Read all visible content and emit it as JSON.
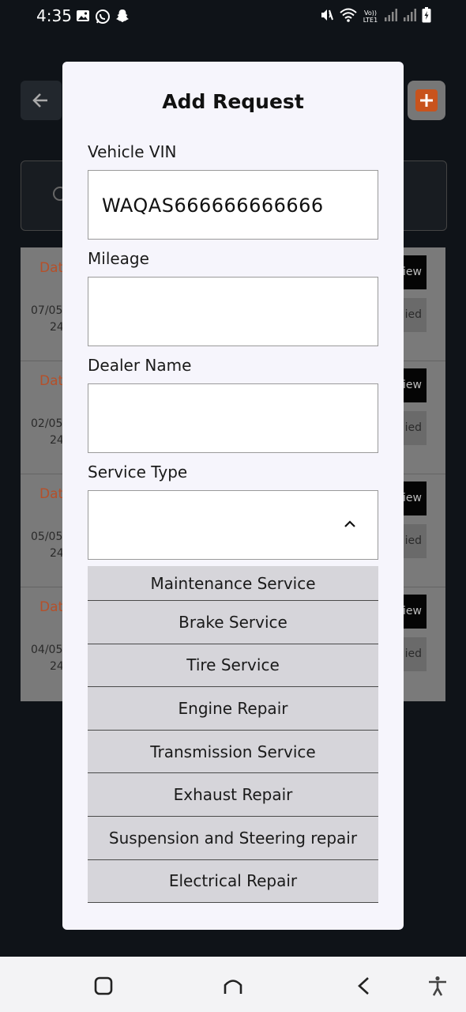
{
  "status_bar": {
    "time": "4:35",
    "left_icons": [
      "image-icon",
      "whatsapp-icon",
      "snapchat-icon"
    ],
    "right_icons": [
      "mute-icon",
      "wifi-icon",
      "volte-icon",
      "signal-icon",
      "signal-icon",
      "battery-icon"
    ],
    "volte_text": "Vo)) LTE1"
  },
  "background": {
    "rows": [
      {
        "label": "Dat",
        "date_line1": "07/05",
        "date_line2": "24",
        "button": "iew",
        "status": "ied"
      },
      {
        "label": "Dat",
        "date_line1": "02/05",
        "date_line2": "24",
        "button": "iew",
        "status": "ied"
      },
      {
        "label": "Dat",
        "date_line1": "05/05",
        "date_line2": "24",
        "button": "iew",
        "status": "ied"
      },
      {
        "label": "Dat",
        "date_line1": "04/05",
        "date_line2": "24",
        "button": "iew",
        "status": "ied"
      }
    ],
    "accent_color": "#c8531d"
  },
  "modal": {
    "title": "Add Request",
    "fields": {
      "vin": {
        "label": "Vehicle VIN",
        "value": "WAQAS666666666666"
      },
      "mileage": {
        "label": "Mileage",
        "value": ""
      },
      "dealer": {
        "label": "Dealer Name",
        "value": ""
      },
      "service_type": {
        "label": "Service Type",
        "value": ""
      }
    },
    "service_options": [
      "Maintenance Service",
      "Brake Service",
      "Tire Service",
      "Engine Repair",
      "Transmission Service",
      "Exhaust Repair",
      "Suspension and Steering repair",
      "Electrical Repair"
    ]
  },
  "nav_bar": {
    "buttons": [
      "recents-icon",
      "home-icon",
      "back-icon",
      "accessibility-icon"
    ]
  }
}
